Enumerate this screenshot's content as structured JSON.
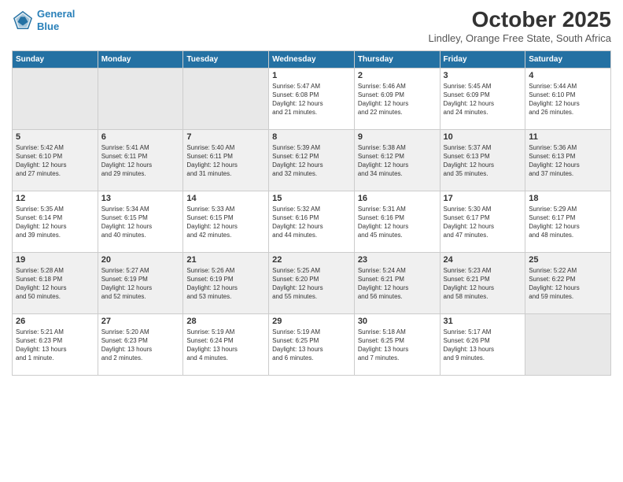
{
  "logo": {
    "line1": "General",
    "line2": "Blue"
  },
  "title": "October 2025",
  "subtitle": "Lindley, Orange Free State, South Africa",
  "headers": [
    "Sunday",
    "Monday",
    "Tuesday",
    "Wednesday",
    "Thursday",
    "Friday",
    "Saturday"
  ],
  "weeks": [
    {
      "shaded": false,
      "days": [
        {
          "num": "",
          "info": ""
        },
        {
          "num": "",
          "info": ""
        },
        {
          "num": "",
          "info": ""
        },
        {
          "num": "1",
          "info": "Sunrise: 5:47 AM\nSunset: 6:08 PM\nDaylight: 12 hours\nand 21 minutes."
        },
        {
          "num": "2",
          "info": "Sunrise: 5:46 AM\nSunset: 6:09 PM\nDaylight: 12 hours\nand 22 minutes."
        },
        {
          "num": "3",
          "info": "Sunrise: 5:45 AM\nSunset: 6:09 PM\nDaylight: 12 hours\nand 24 minutes."
        },
        {
          "num": "4",
          "info": "Sunrise: 5:44 AM\nSunset: 6:10 PM\nDaylight: 12 hours\nand 26 minutes."
        }
      ]
    },
    {
      "shaded": true,
      "days": [
        {
          "num": "5",
          "info": "Sunrise: 5:42 AM\nSunset: 6:10 PM\nDaylight: 12 hours\nand 27 minutes."
        },
        {
          "num": "6",
          "info": "Sunrise: 5:41 AM\nSunset: 6:11 PM\nDaylight: 12 hours\nand 29 minutes."
        },
        {
          "num": "7",
          "info": "Sunrise: 5:40 AM\nSunset: 6:11 PM\nDaylight: 12 hours\nand 31 minutes."
        },
        {
          "num": "8",
          "info": "Sunrise: 5:39 AM\nSunset: 6:12 PM\nDaylight: 12 hours\nand 32 minutes."
        },
        {
          "num": "9",
          "info": "Sunrise: 5:38 AM\nSunset: 6:12 PM\nDaylight: 12 hours\nand 34 minutes."
        },
        {
          "num": "10",
          "info": "Sunrise: 5:37 AM\nSunset: 6:13 PM\nDaylight: 12 hours\nand 35 minutes."
        },
        {
          "num": "11",
          "info": "Sunrise: 5:36 AM\nSunset: 6:13 PM\nDaylight: 12 hours\nand 37 minutes."
        }
      ]
    },
    {
      "shaded": false,
      "days": [
        {
          "num": "12",
          "info": "Sunrise: 5:35 AM\nSunset: 6:14 PM\nDaylight: 12 hours\nand 39 minutes."
        },
        {
          "num": "13",
          "info": "Sunrise: 5:34 AM\nSunset: 6:15 PM\nDaylight: 12 hours\nand 40 minutes."
        },
        {
          "num": "14",
          "info": "Sunrise: 5:33 AM\nSunset: 6:15 PM\nDaylight: 12 hours\nand 42 minutes."
        },
        {
          "num": "15",
          "info": "Sunrise: 5:32 AM\nSunset: 6:16 PM\nDaylight: 12 hours\nand 44 minutes."
        },
        {
          "num": "16",
          "info": "Sunrise: 5:31 AM\nSunset: 6:16 PM\nDaylight: 12 hours\nand 45 minutes."
        },
        {
          "num": "17",
          "info": "Sunrise: 5:30 AM\nSunset: 6:17 PM\nDaylight: 12 hours\nand 47 minutes."
        },
        {
          "num": "18",
          "info": "Sunrise: 5:29 AM\nSunset: 6:17 PM\nDaylight: 12 hours\nand 48 minutes."
        }
      ]
    },
    {
      "shaded": true,
      "days": [
        {
          "num": "19",
          "info": "Sunrise: 5:28 AM\nSunset: 6:18 PM\nDaylight: 12 hours\nand 50 minutes."
        },
        {
          "num": "20",
          "info": "Sunrise: 5:27 AM\nSunset: 6:19 PM\nDaylight: 12 hours\nand 52 minutes."
        },
        {
          "num": "21",
          "info": "Sunrise: 5:26 AM\nSunset: 6:19 PM\nDaylight: 12 hours\nand 53 minutes."
        },
        {
          "num": "22",
          "info": "Sunrise: 5:25 AM\nSunset: 6:20 PM\nDaylight: 12 hours\nand 55 minutes."
        },
        {
          "num": "23",
          "info": "Sunrise: 5:24 AM\nSunset: 6:21 PM\nDaylight: 12 hours\nand 56 minutes."
        },
        {
          "num": "24",
          "info": "Sunrise: 5:23 AM\nSunset: 6:21 PM\nDaylight: 12 hours\nand 58 minutes."
        },
        {
          "num": "25",
          "info": "Sunrise: 5:22 AM\nSunset: 6:22 PM\nDaylight: 12 hours\nand 59 minutes."
        }
      ]
    },
    {
      "shaded": false,
      "days": [
        {
          "num": "26",
          "info": "Sunrise: 5:21 AM\nSunset: 6:23 PM\nDaylight: 13 hours\nand 1 minute."
        },
        {
          "num": "27",
          "info": "Sunrise: 5:20 AM\nSunset: 6:23 PM\nDaylight: 13 hours\nand 2 minutes."
        },
        {
          "num": "28",
          "info": "Sunrise: 5:19 AM\nSunset: 6:24 PM\nDaylight: 13 hours\nand 4 minutes."
        },
        {
          "num": "29",
          "info": "Sunrise: 5:19 AM\nSunset: 6:25 PM\nDaylight: 13 hours\nand 6 minutes."
        },
        {
          "num": "30",
          "info": "Sunrise: 5:18 AM\nSunset: 6:25 PM\nDaylight: 13 hours\nand 7 minutes."
        },
        {
          "num": "31",
          "info": "Sunrise: 5:17 AM\nSunset: 6:26 PM\nDaylight: 13 hours\nand 9 minutes."
        },
        {
          "num": "",
          "info": ""
        }
      ]
    }
  ]
}
